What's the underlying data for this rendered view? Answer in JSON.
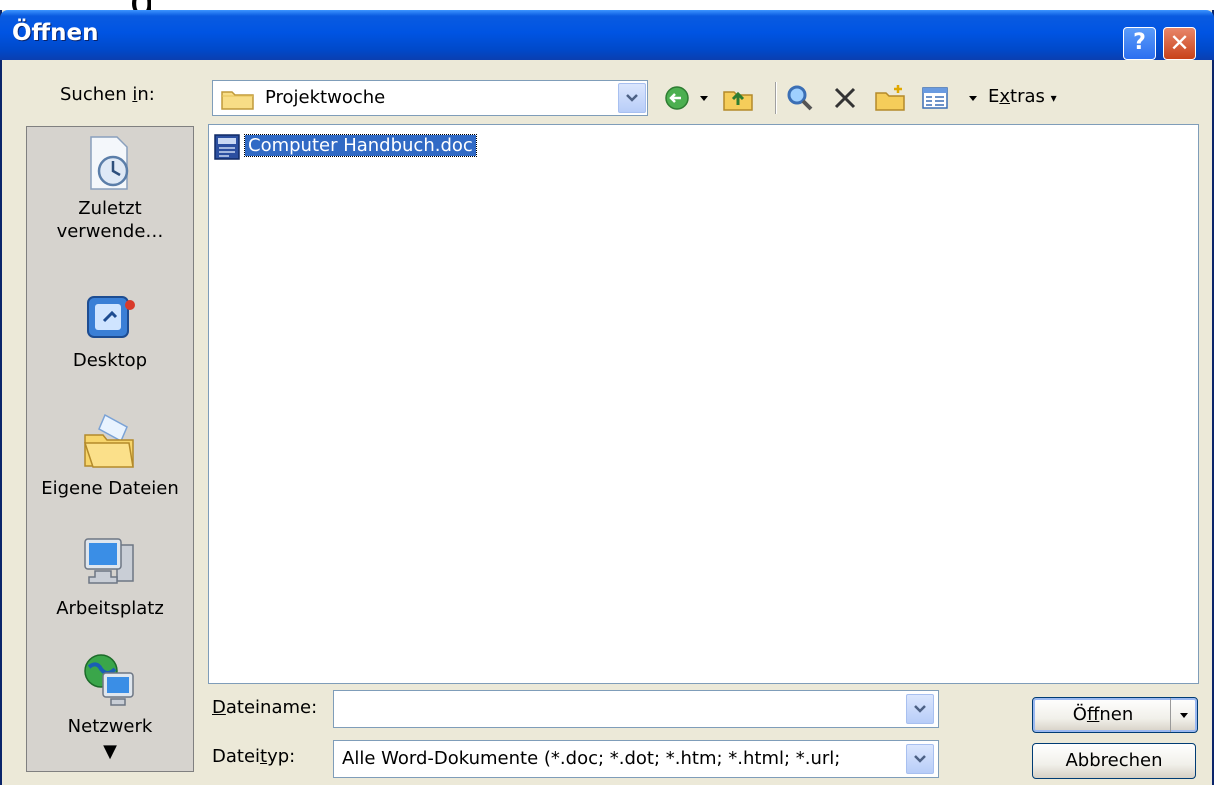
{
  "title": "Öffnen",
  "title_buttons": {
    "help": "?",
    "close": "✕"
  },
  "look_in": {
    "label_pre": "Suchen ",
    "label_key": "i",
    "label_post": "n:",
    "value": "Projektwoche"
  },
  "toolbar": {
    "extras_pre": "E",
    "extras_key": "x",
    "extras_post": "tras",
    "icons": [
      "back-icon",
      "up-folder-icon",
      "search-web-icon",
      "delete-icon",
      "new-folder-icon",
      "views-icon"
    ]
  },
  "places": [
    {
      "line1": "Zuletzt",
      "line2": "verwende…",
      "icon": "recent-icon"
    },
    {
      "line1": "Desktop",
      "line2": "",
      "icon": "desktop-icon"
    },
    {
      "line1": "Eigene Dateien",
      "line2": "",
      "icon": "my-documents-icon"
    },
    {
      "line1": "Arbeitsplatz",
      "line2": "",
      "icon": "my-computer-icon"
    },
    {
      "line1": "Netzwerk",
      "line2": "",
      "icon": "network-icon"
    }
  ],
  "files": [
    {
      "name": "Computer Handbuch.doc",
      "icon": "word-doc-icon",
      "selected": true
    }
  ],
  "filename": {
    "label_key": "D",
    "label_post": "ateiname:",
    "value": ""
  },
  "filetype": {
    "label_pre": "Datei",
    "label_key": "t",
    "label_post": "yp:",
    "value": "Alle Word-Dokumente (*.doc; *.dot; *.htm; *.html; *.url;"
  },
  "buttons": {
    "open_pre": "Ö",
    "open_key": "f",
    "open_post": "fnen",
    "cancel": "Abbrechen"
  },
  "colors": {
    "titlebar": "#0054e3",
    "dialog_bg": "#ece9d8",
    "selection": "#316ac5"
  }
}
